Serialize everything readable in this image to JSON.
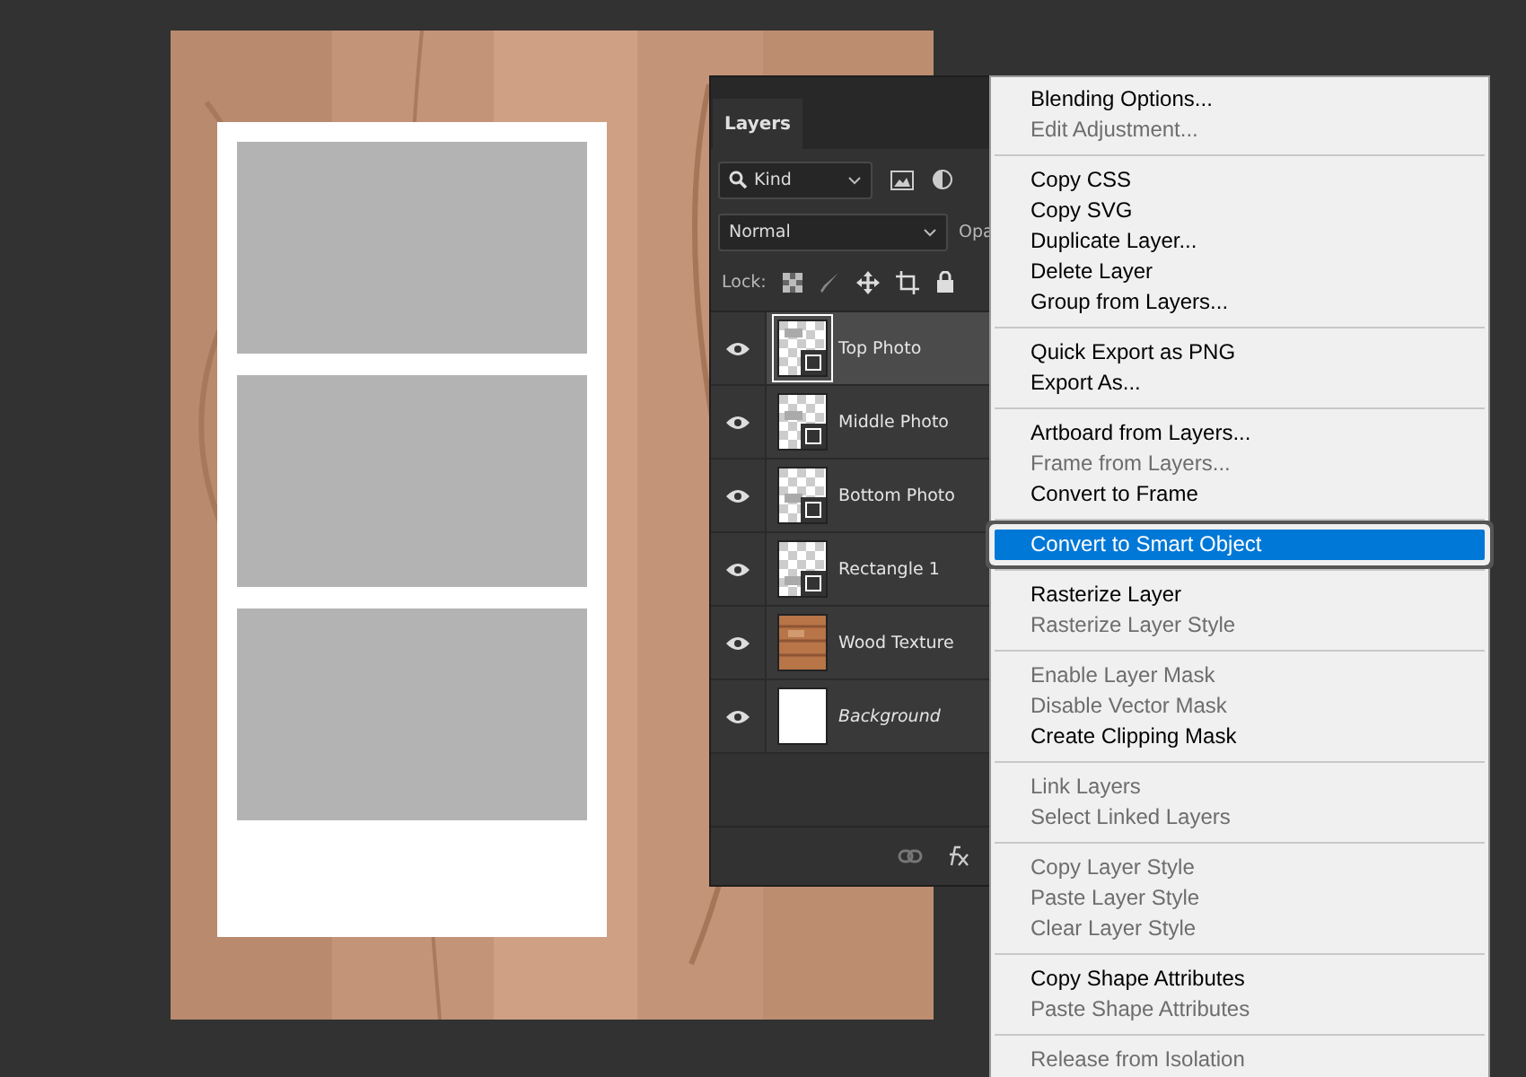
{
  "document": {
    "kind": "picture",
    "slots": [
      {
        "kind": "placeholder"
      },
      {
        "kind": "placeholder"
      },
      {
        "kind": "placeholder"
      }
    ]
  },
  "layers_panel": {
    "tab": {
      "label": "Layers",
      "selected": true
    },
    "filter": {
      "value": "Kind"
    },
    "blend_mode": {
      "value": "Normal"
    },
    "opacity_label": "Opa",
    "lock_label": "Lock:",
    "layers": [
      {
        "name": "Top Photo",
        "kind": "shape",
        "visible": true,
        "selected": true,
        "italic": false
      },
      {
        "name": "Middle Photo",
        "kind": "shape",
        "visible": true,
        "selected": false,
        "italic": false
      },
      {
        "name": "Bottom Photo",
        "kind": "shape",
        "visible": true,
        "selected": false,
        "italic": false
      },
      {
        "name": "Rectangle 1",
        "kind": "shape",
        "visible": true,
        "selected": false,
        "italic": false
      },
      {
        "name": "Wood Texture",
        "kind": "texture",
        "visible": true,
        "selected": false,
        "italic": false
      },
      {
        "name": "Background",
        "kind": "white",
        "visible": true,
        "selected": false,
        "italic": true
      }
    ]
  },
  "context_menu": {
    "groups": [
      [
        {
          "label": "Blending Options...",
          "disabled": false,
          "selected": false
        },
        {
          "label": "Edit Adjustment...",
          "disabled": true,
          "selected": false
        }
      ],
      [
        {
          "label": "Copy CSS",
          "disabled": false,
          "selected": false
        },
        {
          "label": "Copy SVG",
          "disabled": false,
          "selected": false
        },
        {
          "label": "Duplicate Layer...",
          "disabled": false,
          "selected": false
        },
        {
          "label": "Delete Layer",
          "disabled": false,
          "selected": false
        },
        {
          "label": "Group from Layers...",
          "disabled": false,
          "selected": false
        }
      ],
      [
        {
          "label": "Quick Export as PNG",
          "disabled": false,
          "selected": false
        },
        {
          "label": "Export As...",
          "disabled": false,
          "selected": false
        }
      ],
      [
        {
          "label": "Artboard from Layers...",
          "disabled": false,
          "selected": false
        },
        {
          "label": "Frame from Layers...",
          "disabled": true,
          "selected": false
        },
        {
          "label": "Convert to Frame",
          "disabled": false,
          "selected": false
        }
      ],
      [
        {
          "label": "Convert to Smart Object",
          "disabled": false,
          "selected": true
        }
      ],
      [
        {
          "label": "Rasterize Layer",
          "disabled": false,
          "selected": false
        },
        {
          "label": "Rasterize Layer Style",
          "disabled": true,
          "selected": false
        }
      ],
      [
        {
          "label": "Enable Layer Mask",
          "disabled": true,
          "selected": false
        },
        {
          "label": "Disable Vector Mask",
          "disabled": true,
          "selected": false
        },
        {
          "label": "Create Clipping Mask",
          "disabled": false,
          "selected": false
        }
      ],
      [
        {
          "label": "Link Layers",
          "disabled": true,
          "selected": false
        },
        {
          "label": "Select Linked Layers",
          "disabled": true,
          "selected": false
        }
      ],
      [
        {
          "label": "Copy Layer Style",
          "disabled": true,
          "selected": false
        },
        {
          "label": "Paste Layer Style",
          "disabled": true,
          "selected": false
        },
        {
          "label": "Clear Layer Style",
          "disabled": true,
          "selected": false
        }
      ],
      [
        {
          "label": "Copy Shape Attributes",
          "disabled": false,
          "selected": false
        },
        {
          "label": "Paste Shape Attributes",
          "disabled": true,
          "selected": false
        }
      ],
      [
        {
          "label": "Release from Isolation",
          "disabled": true,
          "selected": false
        }
      ]
    ]
  }
}
